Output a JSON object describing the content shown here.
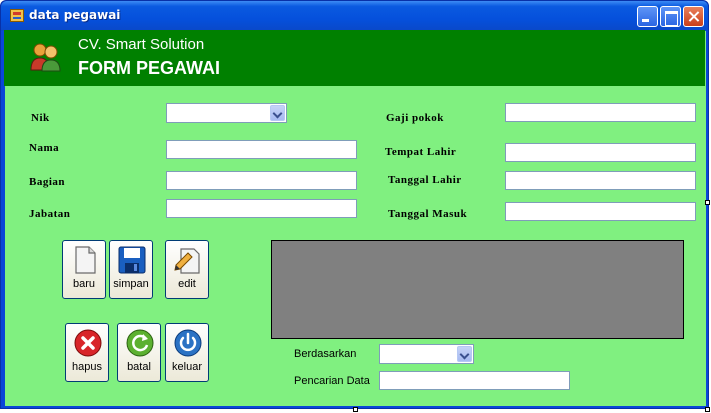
{
  "window": {
    "title": "data pegawai"
  },
  "header": {
    "company": "CV. Smart Solution",
    "form_title": "FORM PEGAWAI"
  },
  "fields": {
    "nik": {
      "label": "Nik",
      "value": ""
    },
    "nama": {
      "label": "Nama",
      "value": ""
    },
    "bagian": {
      "label": "Bagian",
      "value": ""
    },
    "jabatan": {
      "label": "Jabatan",
      "value": ""
    },
    "gaji_pokok": {
      "label": "Gaji pokok",
      "value": ""
    },
    "tempat_lahir": {
      "label": "Tempat Lahir",
      "value": ""
    },
    "tanggal_lahir": {
      "label": "Tanggal Lahir",
      "value": ""
    },
    "tanggal_masuk": {
      "label": "Tanggal Masuk",
      "value": ""
    }
  },
  "buttons": {
    "baru": "baru",
    "simpan": "simpan",
    "edit": "edit",
    "hapus": "hapus",
    "batal": "batal",
    "keluar": "keluar"
  },
  "search": {
    "berdasarkan_label": "Berdasarkan",
    "berdasarkan_value": "",
    "pencarian_label": "Pencarian Data",
    "pencarian_value": ""
  },
  "icons": {
    "window": "app-icon",
    "header": "people-icon",
    "baru": "new-document-icon",
    "simpan": "save-disk-icon",
    "edit": "edit-document-icon",
    "hapus": "delete-x-icon",
    "batal": "refresh-icon",
    "keluar": "power-icon"
  },
  "colors": {
    "form_background": "#80f080",
    "header_background": "#008000",
    "grid_background": "#808080",
    "title_bar": "#0550dc"
  }
}
